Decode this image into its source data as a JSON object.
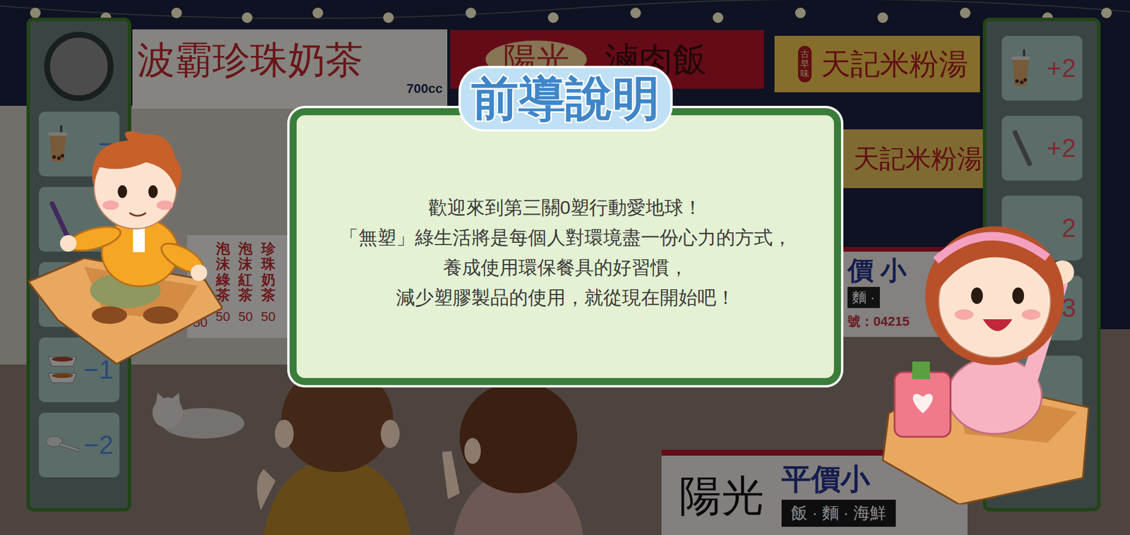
{
  "scene": {
    "tea_shop": {
      "name": "波霸珍珠奶茶",
      "size": "700cc",
      "menu": [
        {
          "name": "泡沫綠茶",
          "price": "50"
        },
        {
          "name": "泡沫紅茶",
          "price": "50"
        },
        {
          "name": "珍珠奶茶",
          "price": "50"
        }
      ],
      "partial_price": "50"
    },
    "rice_stall": {
      "brand": "陽光",
      "name": "滷肉飯"
    },
    "noodle_stall": {
      "tag": "古早味",
      "name": "天記米粉湯",
      "second_name": "天記米粉湯"
    },
    "middle_stall": {
      "name": "價 小",
      "menu": "麵 ·",
      "phone": "號：04215"
    },
    "front_stall": {
      "brand": "陽光",
      "name": "平價小",
      "menu": "飯 · 麵 · 海鮮"
    }
  },
  "left_panel": {
    "items": [
      {
        "kind": "cup",
        "count": "−"
      },
      {
        "kind": "straw",
        "count": ""
      },
      {
        "kind": "hidden",
        "count": ""
      },
      {
        "kind": "box",
        "count": "−1"
      },
      {
        "kind": "spoon",
        "count": "−2"
      }
    ]
  },
  "right_panel": {
    "items": [
      {
        "kind": "cup",
        "count": "+2"
      },
      {
        "kind": "straw",
        "count": "+2"
      },
      {
        "kind": "hidden",
        "count": "2"
      },
      {
        "kind": "hidden",
        "count": "+3"
      },
      {
        "kind": "hidden",
        "count": ""
      }
    ]
  },
  "dialog": {
    "title": "前導說明",
    "lines": [
      "歡迎來到第三關0塑行動愛地球！",
      "「無塑」綠生活將是每個人對環境盡一份心力的方式，",
      "養成使用環保餐具的好習慣，",
      "減少塑膠製品的使用，就從現在開始吧！"
    ]
  }
}
